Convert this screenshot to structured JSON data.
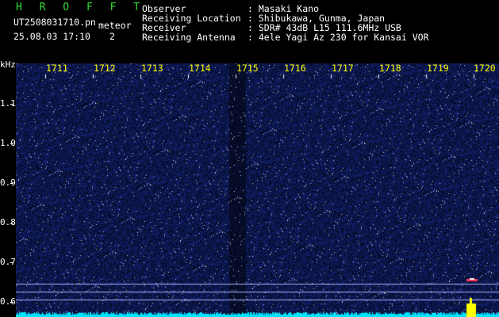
{
  "header": {
    "app_name": "H R O F F T",
    "filename": "UT2508031710.pn",
    "mode": "meteor",
    "datetime": "25.08.03 17:10",
    "channel": "2",
    "info": [
      {
        "label": "Observer",
        "value": ": Masaki Kano"
      },
      {
        "label": "Receiving Location",
        "value": ": Shibukawa, Gunma, Japan"
      },
      {
        "label": "Receiver",
        "value": ": SDR# 43dB L15 111.6MHz USB"
      },
      {
        "label": "Receiving Antenna",
        "value": ": 4ele Yagi Az 230 for Kansai VOR"
      }
    ]
  },
  "axes": {
    "y_unit": "kHz",
    "y_ticks": [
      "1.1",
      "1.0",
      "0.9",
      "0.8",
      "0.7",
      "0.6"
    ],
    "x_ticks": [
      "1711",
      "1712",
      "1713",
      "1714",
      "1715",
      "1716",
      "1717",
      "1718",
      "1719",
      "1720"
    ]
  },
  "colors": {
    "background": "#000010",
    "noise": "#1a2a9a",
    "signal_line": "#aab4ff",
    "baseline": "#00e5ff",
    "marker": "#ffff00",
    "meteor_echo": "#ff3355"
  }
}
